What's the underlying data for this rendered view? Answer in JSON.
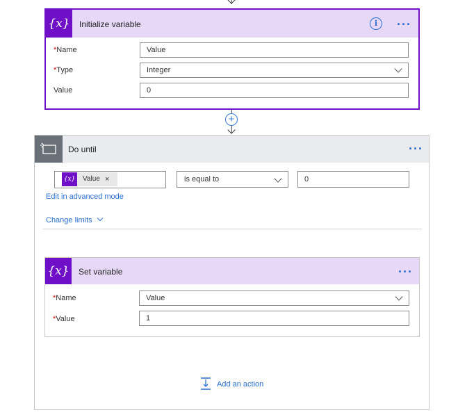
{
  "init_variable": {
    "title": "Initialize variable",
    "icon_glyph": "{x}",
    "info_glyph": "i",
    "more_glyph": "···",
    "name_label": "Name",
    "name_value": "Value",
    "type_label": "Type",
    "type_value": "Integer",
    "value_label": "Value",
    "value_value": "0",
    "required_mark": "*"
  },
  "connector": {
    "plus_glyph": "+"
  },
  "do_until": {
    "title": "Do until",
    "more_glyph": "···",
    "condition_token": "Value",
    "token_remove_glyph": "×",
    "token_icon_glyph": "{x}",
    "operator": "is equal to",
    "compare_value": "0",
    "edit_advanced_link": "Edit in advanced mode",
    "change_limits_link": "Change limits"
  },
  "set_variable": {
    "title": "Set variable",
    "icon_glyph": "{x}",
    "more_glyph": "···",
    "name_label": "Name",
    "name_value": "Value",
    "value_label": "Value",
    "value_value": "1",
    "required_mark": "*"
  },
  "add_action": {
    "label": "Add an action"
  },
  "colors": {
    "accent_purple": "#6f10c8",
    "header_lavender": "#e8d8f7",
    "link_blue": "#2a6ed2",
    "do_until_gray": "#6a7077"
  }
}
